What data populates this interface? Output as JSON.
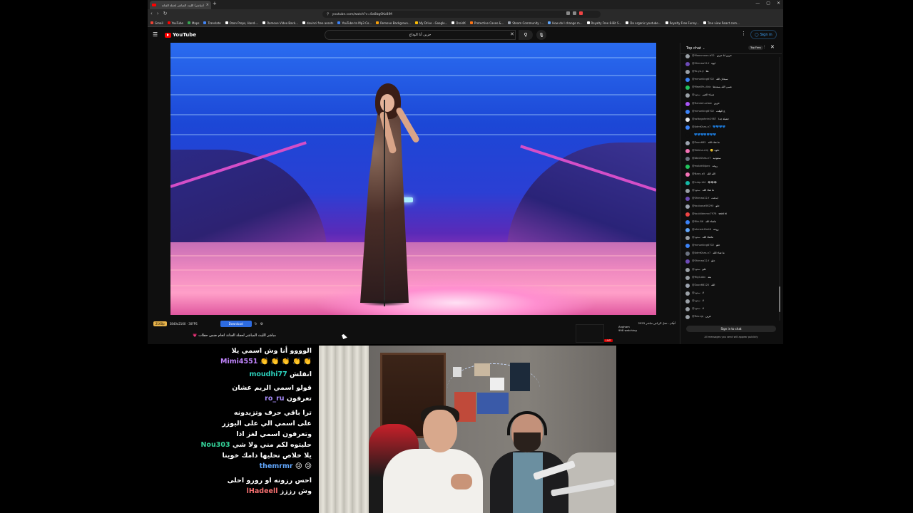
{
  "browser": {
    "tab_title": "(مباشر) الليث المباشر لحفلة الفنانة",
    "url": "youtube.com/watch?v=8a8bg0Ko8IM",
    "bookmarks": [
      {
        "label": "Gmail",
        "color": "#ea4335"
      },
      {
        "label": "YouTube",
        "color": "#ff0000"
      },
      {
        "label": "Maps",
        "color": "#34a853"
      },
      {
        "label": "Translate",
        "color": "#4285f4"
      },
      {
        "label": "Ozon Props, Hand-...",
        "color": "#ffffff"
      },
      {
        "label": "Remove Video Back...",
        "color": "#ffffff"
      },
      {
        "label": "davinci free assets",
        "color": "#ffffff"
      },
      {
        "label": "YouTube to Mp3 Co...",
        "color": "#3b82f6"
      },
      {
        "label": "Remove Backgroun...",
        "color": "#f59e0b"
      },
      {
        "label": "My Drive - Google...",
        "color": "#fbbc05"
      },
      {
        "label": "DroidX",
        "color": "#ffffff"
      },
      {
        "label": "Protective Cases &...",
        "color": "#f97316"
      },
      {
        "label": "Steam Community :...",
        "color": "#9ca3af"
      },
      {
        "label": "How do I change m...",
        "color": "#60a5fa"
      },
      {
        "label": "Royalty Free 8-Bit S...",
        "color": "#ffffff"
      },
      {
        "label": "Do organic youtube...",
        "color": "#ffffff"
      },
      {
        "label": "Royalty Free Funny...",
        "color": "#ffffff"
      },
      {
        "label": "Tree view React com...",
        "color": "#ffffff"
      }
    ]
  },
  "youtube": {
    "logo_text": "YouTube",
    "search_value": "حزين أنا الوداع",
    "signin_label": "Sign in",
    "toolbar": {
      "fps_badge": "2160p",
      "quality": "3840x2160 · 30FPS",
      "download_label": "Download"
    },
    "video_title": "مباشر الليث المباشر لحفلة الفنانة انغام ضمن حفلات 💗",
    "suggestion": {
      "title": "أنغام - حفل الرياض مباشر 2025",
      "channel": "Angham",
      "meta": "998 watching",
      "live": "LIVE"
    },
    "live_chat": {
      "title": "Top chat",
      "pill": "Top Fans",
      "signin_label": "Sign in to chat",
      "footer": "All messages you send will appear publicly",
      "messages": [
        {
          "name": "@Moonmoon-b52",
          "text": "حزين انا حزين",
          "color": "#9aa0a6"
        },
        {
          "name": "@Shimaa12-f",
          "text": "ايوه",
          "color": "#6c4ab6"
        },
        {
          "name": "@Yo-yo-ji",
          "text": "هلا",
          "color": "#9aa0a6"
        },
        {
          "name": "@mmorking6702",
          "text": "سبحان الله",
          "color": "#3b82f6"
        },
        {
          "name": "@Mew09u-0dz",
          "text": "عسى الله يسعدها",
          "color": "#22c55e"
        },
        {
          "name": "@سعود",
          "text": "مساء الخير",
          "color": "#9aa0a6"
        },
        {
          "name": "@Haneen-wlow",
          "text": "حزين",
          "color": "#a855f7"
        },
        {
          "name": "@mmorking6702",
          "text": "ع الوقت",
          "color": "#3b82f6"
        },
        {
          "name": "@azItagahrdn1987",
          "text": "جميلة جدا",
          "color": "#e5e7eb"
        },
        {
          "name": "@AdmKhas-n7",
          "text": "💙💙💙💙",
          "color": "#3b82f6"
        },
        {
          "name": "",
          "text": "💙💙💙💙💙💙💙",
          "color": "#0f0f0f"
        },
        {
          "name": "@Zoon665",
          "text": "ما شاء الله",
          "color": "#9ca3af"
        },
        {
          "name": "@Fatima-mtj",
          "text": "حلوه 🙂",
          "color": "#f472b6"
        },
        {
          "name": "@Abd-Khas-n7",
          "text": "سعوديه",
          "color": "#6b7280"
        },
        {
          "name": "@malak64pec",
          "text": "روعه",
          "color": "#22c55e"
        },
        {
          "name": "@Nazy-q5",
          "text": "الله الله",
          "color": "#f472b6"
        },
        {
          "name": "@Lulq-n64",
          "text": "😂😂😂",
          "color": "#14b8a6"
        },
        {
          "name": "@سعود",
          "text": "ما شاء الله",
          "color": "#9aa0a6"
        },
        {
          "name": "@Shimaa12-f",
          "text": "ابدعت",
          "color": "#6c4ab6"
        },
        {
          "name": "@touloose56290",
          "text": "حلو",
          "color": "#9ca3af"
        },
        {
          "name": "@touldidmmn7976",
          "text": "said hi",
          "color": "#ef4444"
        },
        {
          "name": "@Rkk-86",
          "text": "ماشاء الله",
          "color": "#3b82f6"
        },
        {
          "name": "@ahmed-Bmt6",
          "text": "روعه",
          "color": "#60a5fa"
        },
        {
          "name": "@سعود",
          "text": "ماشاء الله",
          "color": "#9aa0a6"
        },
        {
          "name": "@mmorking6702",
          "text": "حلو",
          "color": "#3b82f6"
        },
        {
          "name": "@AdmKhas-n7",
          "text": "ما شاء الله",
          "color": "#6b7280"
        },
        {
          "name": "@Shimaa12-f",
          "text": "حلو",
          "color": "#6c4ab6"
        },
        {
          "name": "@سعود",
          "text": "حلو",
          "color": "#9aa0a6"
        },
        {
          "name": "@Higli-abc",
          "text": "بعد",
          "color": "#9aa0a6"
        },
        {
          "name": "@Zoon66120",
          "text": "الله",
          "color": "#9ca3af"
        },
        {
          "name": "@سعود",
          "text": "لا",
          "color": "#9aa0a6"
        },
        {
          "name": "@سعود",
          "text": "لا",
          "color": "#9aa0a6"
        },
        {
          "name": "@سعود",
          "text": "لا",
          "color": "#9aa0a6"
        },
        {
          "name": "@Rav-qq",
          "text": "حزين",
          "color": "#9aa0a6"
        }
      ]
    }
  },
  "stream_chat": [
    {
      "user": "Mimi4551",
      "color": "#c084fc",
      "text": "الوووو أنا وش اسمي يلا\n👏 👏 👏 👏 👏"
    },
    {
      "user": "moudhi77",
      "color": "#2dd4bf",
      "text": "انقلش"
    },
    {
      "user": "ro_ru",
      "color": "#a78bfa",
      "text": "قولو اسمي الريم عشان\nتعرفون"
    },
    {
      "user": "Nou303",
      "color": "#34d399",
      "text": "ترا باقي حرف وتزيدونه\nعلى اسمي الي على اليوزر\nوتعرفون اسمي لغز اذا\nحليتوه لكم مني ولا شي"
    },
    {
      "user": "themrmr",
      "color": "#60a5fa",
      "text": "يلا خلاص نحليها دامك خوينا\n😢 😢"
    },
    {
      "user": "lHadeell",
      "color": "#f87171",
      "text": "احس رزونه او رورو احلى\nوش رززز"
    }
  ]
}
